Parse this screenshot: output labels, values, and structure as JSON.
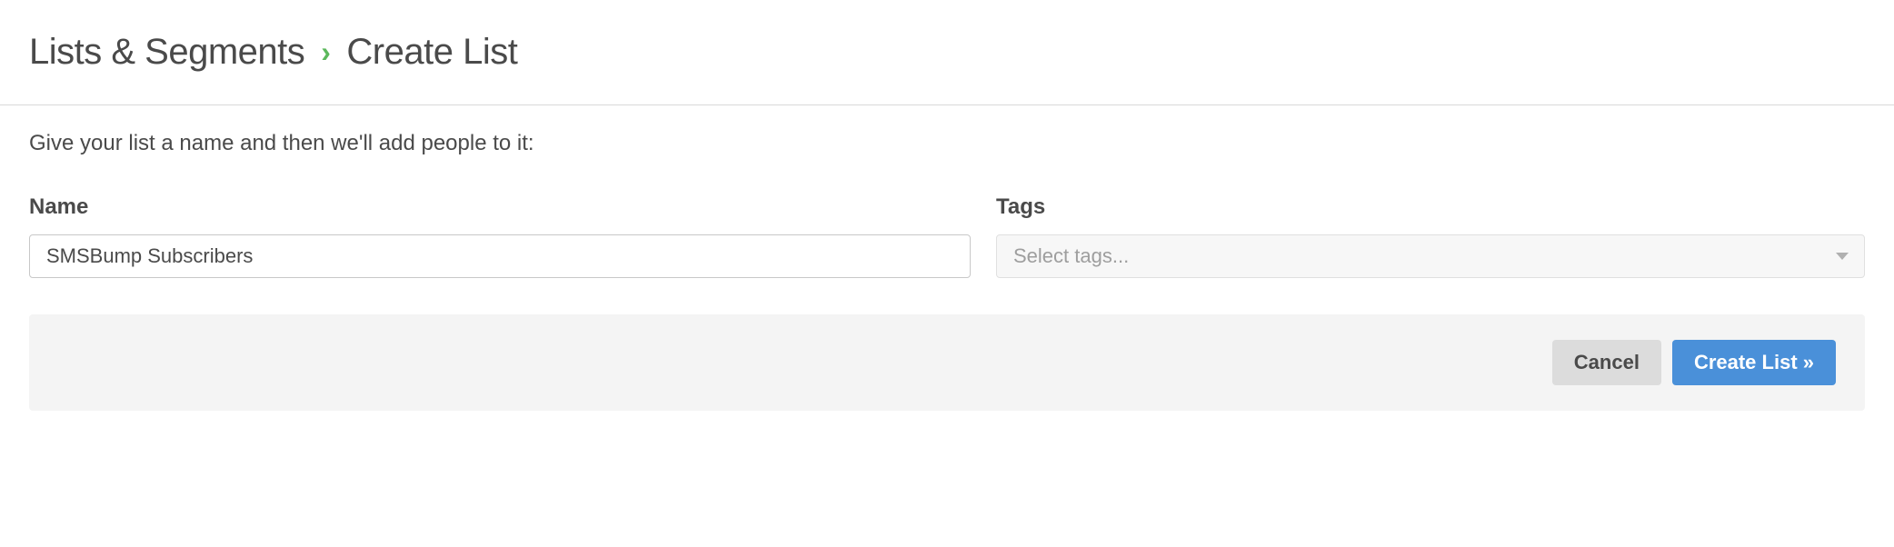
{
  "breadcrumb": {
    "root": "Lists & Segments",
    "current": "Create List"
  },
  "instruction": "Give your list a name and then we'll add people to it:",
  "form": {
    "name_label": "Name",
    "name_value": "SMSBump Subscribers",
    "tags_label": "Tags",
    "tags_placeholder": "Select tags..."
  },
  "actions": {
    "cancel": "Cancel",
    "submit": "Create List »"
  }
}
